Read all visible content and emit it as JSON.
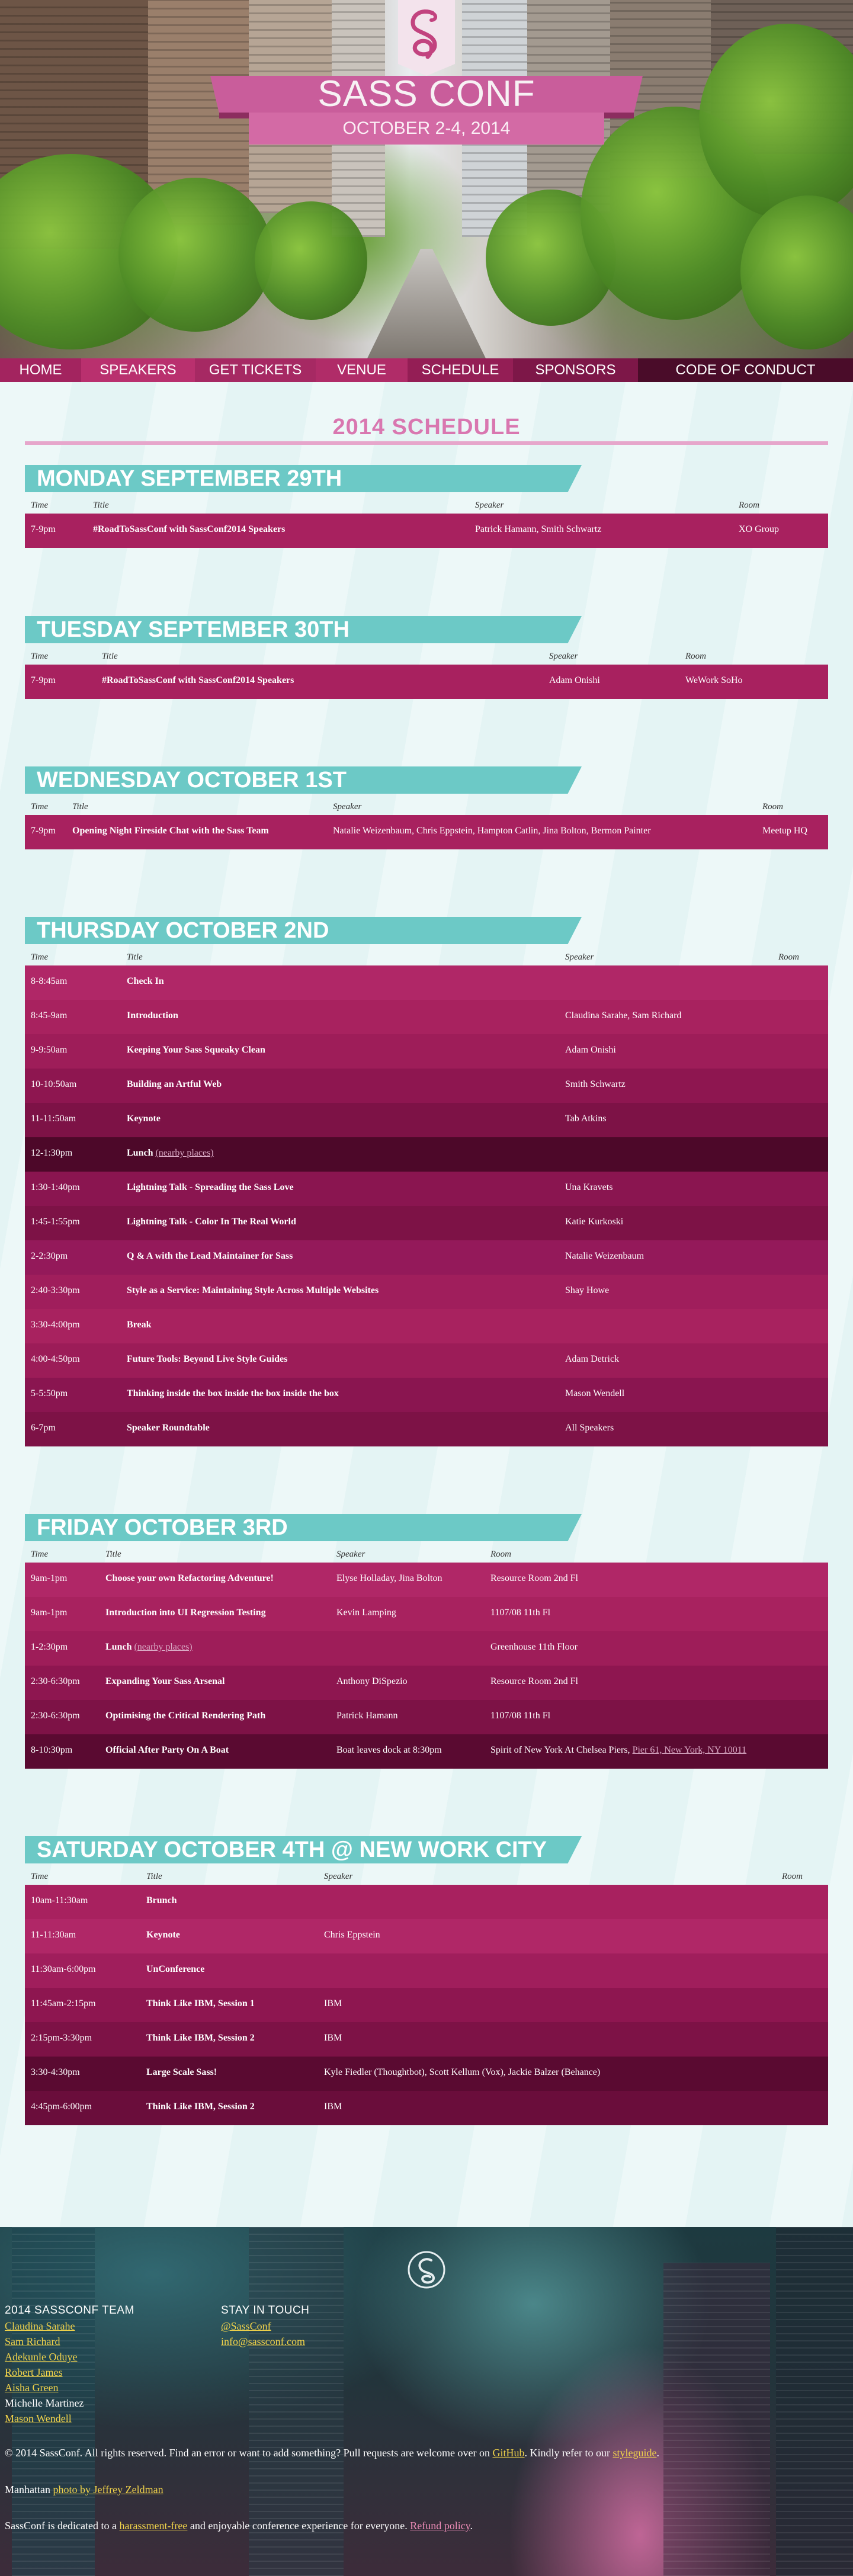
{
  "hero": {
    "title": "SASS CONF",
    "dates": "OCTOBER 2-4, 2014"
  },
  "nav": [
    {
      "label": "HOME",
      "color": "#a3245f"
    },
    {
      "label": "SPEAKERS",
      "color": "#b9306e"
    },
    {
      "label": "GET TICKETS",
      "color": "#a62963"
    },
    {
      "label": "VENUE",
      "color": "#b02c68"
    },
    {
      "label": "SCHEDULE",
      "color": "#941e55"
    },
    {
      "label": "SPONSORS",
      "color": "#7d1748"
    },
    {
      "label": "CODE OF CONDUCT",
      "color": "#4a0c29"
    }
  ],
  "schedule_title": "2014 SCHEDULE",
  "columns": {
    "time": "Time",
    "title": "Title",
    "speaker": "Speaker",
    "room": "Room"
  },
  "days": [
    {
      "heading": "MONDAY SEPTEMBER 29TH",
      "rows": [
        {
          "time": "7-9pm",
          "title": "#RoadToSassConf with SassConf2014 Speakers",
          "speaker": "Patrick Hamann, Smith Schwartz",
          "room": "XO Group"
        }
      ]
    },
    {
      "heading": "TUESDAY SEPTEMBER 30TH",
      "rows": [
        {
          "time": "7-9pm",
          "title": "#RoadToSassConf with SassConf2014 Speakers",
          "speaker": "Adam Onishi",
          "room": "WeWork SoHo"
        }
      ]
    },
    {
      "heading": "WEDNESDAY OCTOBER 1ST",
      "rows": [
        {
          "time": "7-9pm",
          "title": "Opening Night Fireside Chat with the Sass Team",
          "speaker": "Natalie Weizenbaum, Chris Eppstein, Hampton Catlin, Jina Bolton, Bermon Painter",
          "room": "Meetup HQ"
        }
      ]
    },
    {
      "heading": "THURSDAY OCTOBER 2ND",
      "rows": [
        {
          "time": "8-8:45am",
          "title": "Check In",
          "speaker": "",
          "room": ""
        },
        {
          "time": "8:45-9am",
          "title": "Introduction",
          "speaker": "Claudina Sarahe, Sam Richard",
          "room": ""
        },
        {
          "time": "9-9:50am",
          "title": "Keeping Your Sass Squeaky Clean",
          "speaker": "Adam Onishi",
          "room": ""
        },
        {
          "time": "10-10:50am",
          "title": "Building an Artful Web",
          "speaker": "Smith Schwartz",
          "room": ""
        },
        {
          "time": "11-11:50am",
          "title": "Keynote",
          "speaker": "Tab Atkins",
          "room": ""
        },
        {
          "time": "12-1:30pm",
          "title": "Lunch",
          "link": "(nearby places)",
          "speaker": "",
          "room": ""
        },
        {
          "time": "1:30-1:40pm",
          "title": "Lightning Talk - Spreading the Sass Love",
          "speaker": "Una Kravets",
          "room": ""
        },
        {
          "time": "1:45-1:55pm",
          "title": "Lightning Talk - Color In The Real World",
          "speaker": "Katie Kurkoski",
          "room": ""
        },
        {
          "time": "2-2:30pm",
          "title": "Q & A with the Lead Maintainer for Sass",
          "speaker": "Natalie Weizenbaum",
          "room": ""
        },
        {
          "time": "2:40-3:30pm",
          "title": "Style as a Service: Maintaining Style Across Multiple Websites",
          "speaker": "Shay Howe",
          "room": ""
        },
        {
          "time": "3:30-4:00pm",
          "title": "Break",
          "speaker": "",
          "room": ""
        },
        {
          "time": "4:00-4:50pm",
          "title": "Future Tools: Beyond Live Style Guides",
          "speaker": "Adam Detrick",
          "room": ""
        },
        {
          "time": "5-5:50pm",
          "title": "Thinking inside the box inside the box inside the box",
          "speaker": "Mason Wendell",
          "room": ""
        },
        {
          "time": "6-7pm",
          "title": "Speaker Roundtable",
          "speaker": "All Speakers",
          "room": ""
        }
      ]
    },
    {
      "heading": "FRIDAY OCTOBER 3RD",
      "rows": [
        {
          "time": "9am-1pm",
          "title": "Choose your own Refactoring Adventure!",
          "speaker": "Elyse Holladay, Jina Bolton",
          "room": "Resource Room 2nd Fl"
        },
        {
          "time": "9am-1pm",
          "title": "Introduction into UI Regression Testing",
          "speaker": "Kevin Lamping",
          "room": "1107/08 11th Fl"
        },
        {
          "time": "1-2:30pm",
          "title": "Lunch",
          "link": "(nearby places)",
          "speaker": "",
          "room": "Greenhouse 11th Floor"
        },
        {
          "time": "2:30-6:30pm",
          "title": "Expanding Your Sass Arsenal",
          "speaker": "Anthony DiSpezio",
          "room": "Resource Room 2nd Fl"
        },
        {
          "time": "2:30-6:30pm",
          "title": "Optimising the Critical Rendering Path",
          "speaker": "Patrick Hamann",
          "room": "1107/08 11th Fl"
        },
        {
          "time": "8-10:30pm",
          "title": "Official After Party On A Boat",
          "speaker": "Boat leaves dock at 8:30pm",
          "room": "Spirit of New York At Chelsea Piers,",
          "room_link": "Pier 61, New York, NY 10011"
        }
      ]
    },
    {
      "heading": "SATURDAY OCTOBER 4TH @ NEW WORK CITY",
      "rows": [
        {
          "time": "10am-11:30am",
          "title": "Brunch",
          "speaker": "",
          "room": ""
        },
        {
          "time": "11-11:30am",
          "title": "Keynote",
          "speaker": "Chris Eppstein",
          "room": ""
        },
        {
          "time": "11:30am-6:00pm",
          "title": "UnConference",
          "speaker": "",
          "room": ""
        },
        {
          "time": "11:45am-2:15pm",
          "title": "Think Like IBM, Session 1",
          "speaker": "IBM",
          "room": ""
        },
        {
          "time": "2:15pm-3:30pm",
          "title": "Think Like IBM, Session 2",
          "speaker": "IBM",
          "room": ""
        },
        {
          "time": "3:30-4:30pm",
          "title": "Large Scale Sass!",
          "speaker": "Kyle Fiedler (Thoughtbot), Scott Kellum (Vox), Jackie Balzer (Behance)",
          "room": ""
        },
        {
          "time": "4:45pm-6:00pm",
          "title": "Think Like IBM, Session 2",
          "speaker": "IBM",
          "room": ""
        }
      ]
    }
  ],
  "footer": {
    "team_heading": "2014 SASSCONF TEAM",
    "team": [
      {
        "name": "Claudina Sarahe",
        "link": true
      },
      {
        "name": "Sam Richard",
        "link": true
      },
      {
        "name": "Adekunle Oduye",
        "link": true
      },
      {
        "name": "Robert James",
        "link": true
      },
      {
        "name": "Aisha Green",
        "link": true
      },
      {
        "name": "Michelle Martinez",
        "link": false
      },
      {
        "name": "Mason Wendell",
        "link": true
      }
    ],
    "touch_heading": "STAY IN TOUCH",
    "touch": [
      "@SassConf",
      "info@sassconf.com"
    ],
    "legal_prefix": "© 2014 SassConf. All rights reserved. Find an error or want to add something? Pull requests are welcome over on ",
    "legal_github": "GitHub",
    "legal_mid": ". Kindly refer to our ",
    "legal_styleguide": "styleguide",
    "legal_end": ".",
    "photo_prefix": "Manhattan ",
    "photo_link": "photo by Jeffrey Zeldman",
    "coc_prefix": "SassConf is dedicated to a ",
    "coc_link": "harassment-free",
    "coc_mid": " and enjoyable conference experience for everyone. ",
    "coc_policy": "Refund policy",
    "coc_end": "."
  },
  "colors": {
    "row_palette": [
      "#a8215f",
      "#9c1c58",
      "#b22769",
      "#8e1650",
      "#7d1246",
      "#5a0a31",
      "#480726"
    ],
    "day_banner": "#6cc9c6",
    "accent_pink": "#d977b0",
    "link_yellow": "#f1d34a"
  }
}
